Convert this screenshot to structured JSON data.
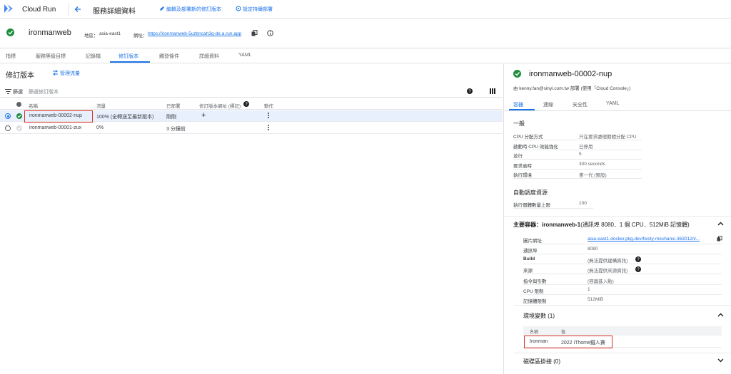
{
  "topbar": {
    "app_title": "Cloud Run",
    "page_title": "服務詳細資料",
    "edit_label": "編輯及部署新的修訂版本",
    "deploy_label": "設定持續部署"
  },
  "service": {
    "name": "ironmanweb",
    "region_label": "地區：",
    "region": "asia-east1",
    "url_label": "網址：",
    "url": "https://ironmanweb-5uzbncah3q-de.a.run.app"
  },
  "tabs": [
    "指標",
    "服務等級目標",
    "記錄檔",
    "修訂版本",
    "觸發條件",
    "詳細資料",
    "YAML"
  ],
  "revisions": {
    "heading": "修訂版本",
    "manage_traffic": "管理流量",
    "filter_label": "篩選",
    "filter_placeholder": "篩選修訂版本",
    "columns": {
      "name": "名稱",
      "traffic": "流量",
      "deployed": "已部署",
      "url_tag": "修訂版本網址 (標記)",
      "actions": "動作"
    },
    "rows": [
      {
        "name": "ironmanweb-00002-nup",
        "traffic": "100% (全轉送至最新版本)",
        "deployed": "剛剛",
        "selected": true,
        "status": "green"
      },
      {
        "name": "ironmanweb-00001-zux",
        "traffic": "0%",
        "deployed": "3 分鐘前",
        "selected": false,
        "status": "grey"
      }
    ]
  },
  "detail": {
    "title": "ironmanweb-00002-nup",
    "subtitle": "由 kenny.fan@sinyi.com.tw 部署 (使用「Cloud Console」)",
    "tabs": [
      "容器",
      "連線",
      "安全性",
      "YAML"
    ],
    "general_heading": "一般",
    "general": [
      {
        "k": "CPU 分配方式",
        "v": "只在要求處理期間分配 CPU"
      },
      {
        "k": "啟動時 CPU 效能強化",
        "v": "已停用"
      },
      {
        "k": "並行",
        "v": "5"
      },
      {
        "k": "要求逾時",
        "v": "300 seconds"
      },
      {
        "k": "執行環境",
        "v": "第一代 (預設)"
      }
    ],
    "autoscale_heading": "自動調度資源",
    "autoscale": [
      {
        "k": "執行個體數量上限",
        "v": "100"
      }
    ],
    "container_heading_bold": "主要容器：ironmanweb-1",
    "container_heading_rest": "(通訊埠 8080．1 個 CPU．512MiB 記憶體)",
    "container": [
      {
        "k": "圖片網址",
        "v": "asia-east1-docker.pkg.dev/feisty-mechanic-363012/ir..."
      },
      {
        "k": "通訊埠",
        "v": "8080"
      },
      {
        "k": "Build",
        "v": "(無法提供建構資訊)"
      },
      {
        "k": "來源",
        "v": "(無法提供來源資訊)"
      },
      {
        "k": "指令與引數",
        "v": "(容器進入點)"
      },
      {
        "k": "CPU 限制",
        "v": "1"
      },
      {
        "k": "記憶體限制",
        "v": "512MiB"
      }
    ],
    "env_heading": "環境變數 (1)",
    "env_cols": {
      "name": "名稱",
      "value": "值"
    },
    "env_rows": [
      {
        "name": "Ironman",
        "value": "2022 iThome鐵人賽"
      }
    ],
    "volume_heading": "磁碟區掛接 (0)"
  }
}
